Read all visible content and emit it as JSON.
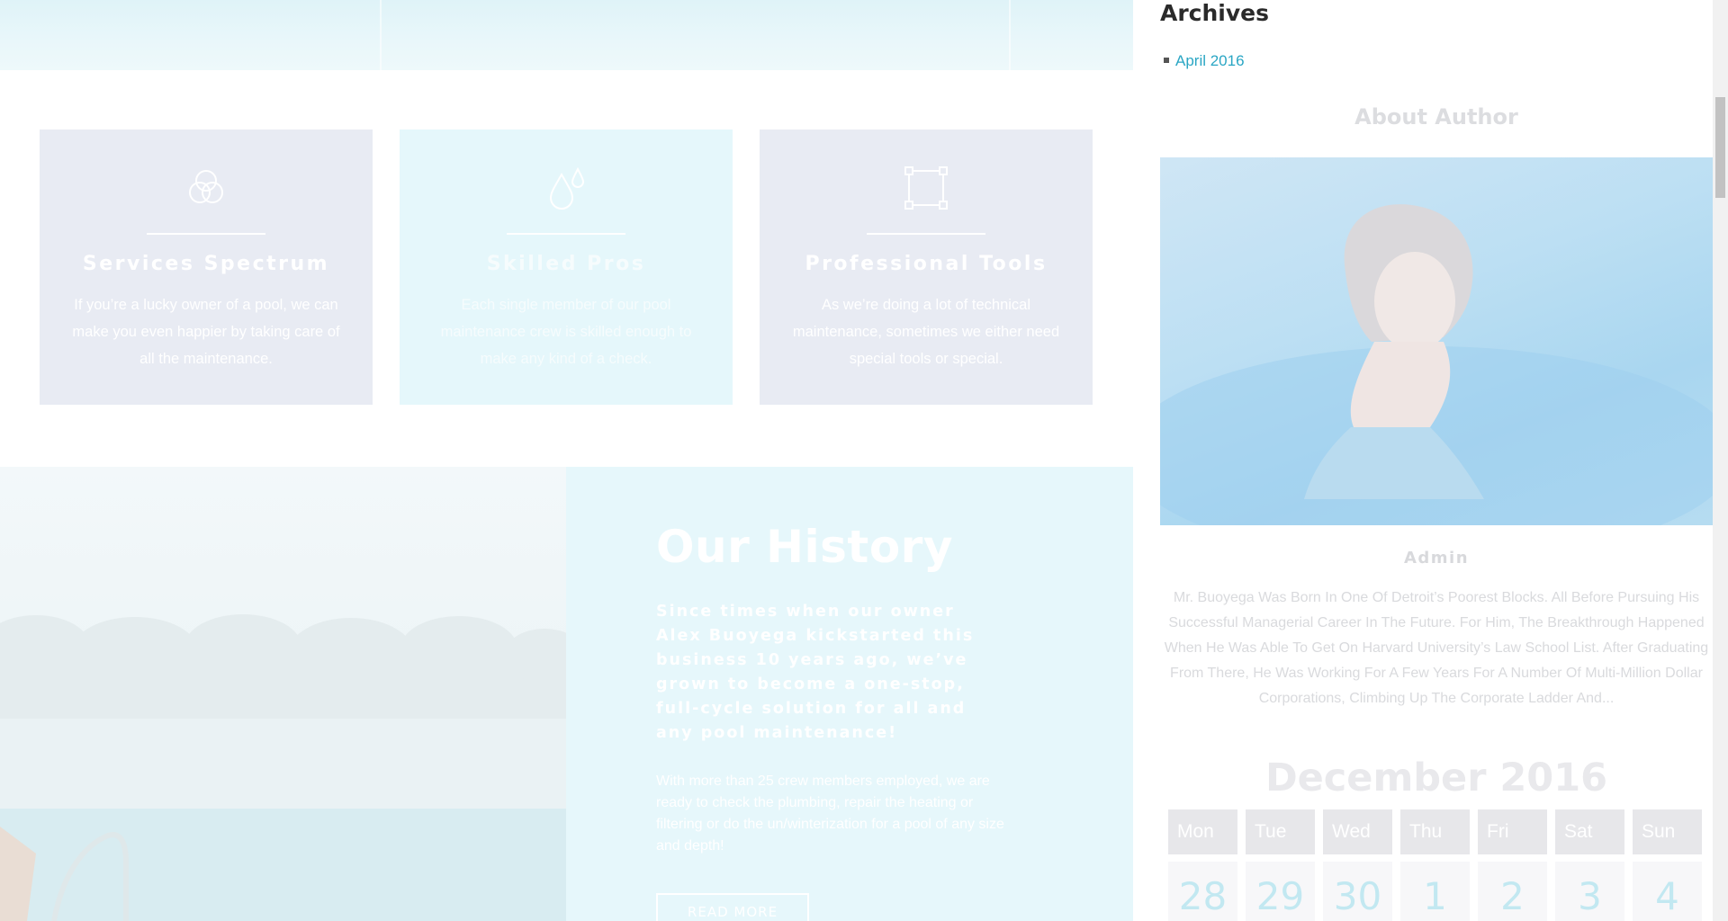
{
  "services": [
    {
      "title": "Services Spectrum",
      "text": "If you’re a lucky owner of a pool, we can make you even happier by taking care of all the maintenance.",
      "icon": "venn-circles-icon"
    },
    {
      "title": "Skilled Pros",
      "text": "Each single member of our pool maintenance crew is skilled enough to make any kind of a check.",
      "icon": "water-drops-icon"
    },
    {
      "title": "Professional Tools",
      "text": "As we’re doing a lot of technical maintenance, sometimes we either need special tools or special.",
      "icon": "vector-square-icon"
    }
  ],
  "history": {
    "title": "Our History",
    "lead": "Since times when our owner Alex Buoyega kickstarted this business 10 years ago, we’ve grown to become a one-stop, full-cycle solution for all and any pool maintenance!",
    "body": "With more than 25 crew members employed, we are ready to check the plumbing, repair the heating or filtering or do the un/winterization for a pool of any size and depth!",
    "button": "READ MORE"
  },
  "sidebar": {
    "archives_title": "Archives",
    "archives": [
      "April 2016"
    ],
    "about_title": "About Author",
    "author_name": "Admin",
    "author_bio": "Mr. Buoyega Was Born In One Of Detroit’s Poorest Blocks. All Before Pursuing His Successful Managerial Career In The Future. For Him, The Breakthrough Happened When He Was Able To Get On Harvard University’s Law School List. After Graduating From There, He Was Working For A Few Years For A Number Of Multi-Million Dollar Corporations, Climbing Up The Corporate Ladder And...",
    "calendar": {
      "title": "December 2016",
      "weekdays": [
        "Mon",
        "Tue",
        "Wed",
        "Thu",
        "Fri",
        "Sat",
        "Sun"
      ],
      "first_row": [
        "28",
        "29",
        "30",
        "1",
        "2",
        "3",
        "4"
      ]
    }
  },
  "colors": {
    "accent": "#2aa6c4",
    "card_gray": "#e8ebf3",
    "card_cyan": "#e5f7fb",
    "history_panel": "#e6f7fb"
  }
}
